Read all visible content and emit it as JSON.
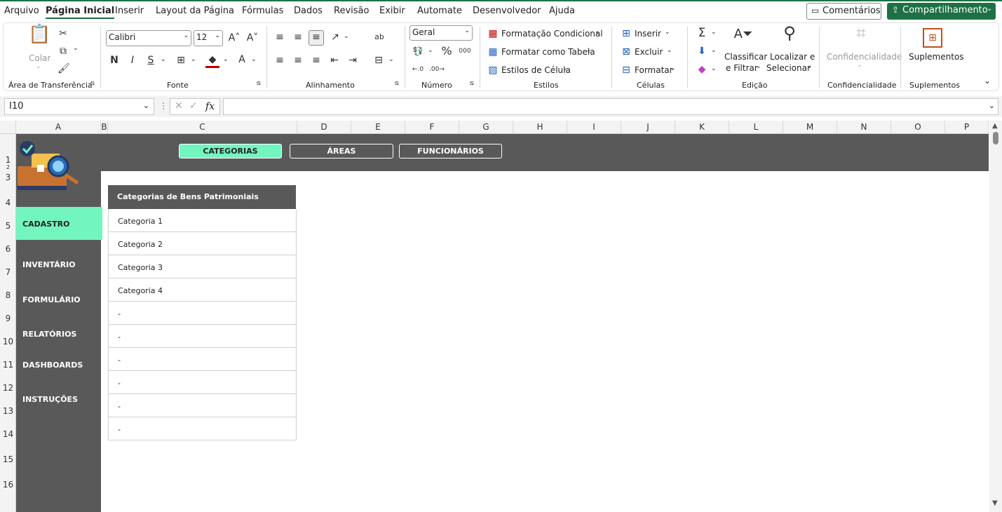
{
  "menu": {
    "items": [
      "Arquivo",
      "Página Inicial",
      "Inserir",
      "Layout da Página",
      "Fórmulas",
      "Dados",
      "Revisão",
      "Exibir",
      "Automate",
      "Desenvolvedor",
      "Ajuda"
    ],
    "comments_label": "Comentários",
    "share_label": "Compartilhamento"
  },
  "ribbon": {
    "clipboard": {
      "paste_label": "Colar",
      "group": "Área de Transferência"
    },
    "font": {
      "name": "Calibri",
      "size": "12",
      "group": "Fonte",
      "bold": "N",
      "italic": "I",
      "underline": "S"
    },
    "alignment": {
      "group": "Alinhamento"
    },
    "number": {
      "format": "Geral",
      "group": "Número"
    },
    "styles": {
      "conditional": "Formatação Condicional",
      "as_table": "Formatar como Tabela",
      "cell_styles": "Estilos de Célula",
      "group": "Estilos"
    },
    "cells": {
      "insert": "Inserir",
      "delete": "Excluir",
      "format": "Formatar",
      "group": "Células"
    },
    "editing": {
      "sort_line1": "Classificar",
      "sort_line2": "e Filtrar",
      "find_line1": "Localizar e",
      "find_line2": "Selecionar",
      "group": "Edição"
    },
    "sensitivity": {
      "label": "Confidencialidade",
      "group": "Confidencialidade"
    },
    "addins": {
      "label": "Suplementos",
      "group": "Suplementos"
    }
  },
  "formula_bar": {
    "name_box": "I10",
    "fx": "fx",
    "value": ""
  },
  "columns": [
    "A",
    "B",
    "C",
    "D",
    "E",
    "F",
    "G",
    "H",
    "I",
    "J",
    "K",
    "L",
    "M",
    "N",
    "O",
    "P"
  ],
  "rows": [
    "1",
    "2",
    "3",
    "4",
    "5",
    "6",
    "7",
    "8",
    "9",
    "10",
    "11",
    "12",
    "13",
    "14",
    "15",
    "16"
  ],
  "sheet": {
    "tabs": [
      "CATEGORIAS",
      "ÁREAS",
      "FUNCIONÁRIOS"
    ],
    "nav": [
      "CADASTRO",
      "INVENTÁRIO",
      "FORMULÁRIO",
      "RELATÓRIOS",
      "DASHBOARDS",
      "INSTRUÇÕES"
    ],
    "table_title": "Categorias de Bens Patrimoniais",
    "table_rows": [
      "Categoria 1",
      "Categoria 2",
      "Categoria 3",
      "Categoria 4",
      "-",
      "-",
      "-",
      "-",
      "-",
      "-"
    ]
  },
  "colors": {
    "accent": "#73f5c0",
    "dark": "#595959",
    "excel_green": "#1e7145"
  }
}
